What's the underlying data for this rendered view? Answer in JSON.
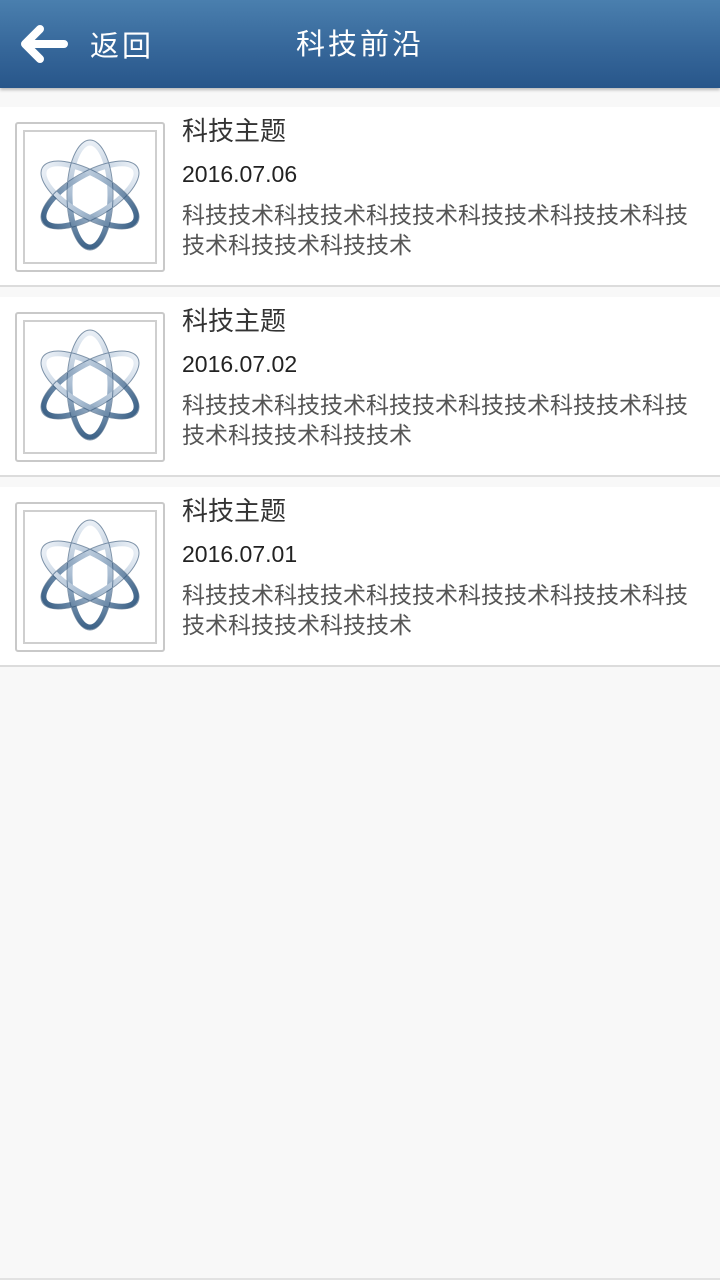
{
  "header": {
    "back_label": "返回",
    "title": "科技前沿"
  },
  "items": [
    {
      "title": "科技主题",
      "date": "2016.07.06",
      "desc": "科技技术科技技术科技技术科技技术科技技术科技技术科技技术科技技术",
      "icon": "atom-icon"
    },
    {
      "title": "科技主题",
      "date": "2016.07.02",
      "desc": "科技技术科技技术科技技术科技技术科技技术科技技术科技技术科技技术",
      "icon": "atom-icon"
    },
    {
      "title": "科技主题",
      "date": "2016.07.01",
      "desc": "科技技术科技技术科技技术科技技术科技技术科技技术科技技术科技技术",
      "icon": "atom-icon"
    }
  ],
  "colors": {
    "header_top": "#4a7fae",
    "header_bottom": "#28568a",
    "background": "#f8f8f8"
  }
}
